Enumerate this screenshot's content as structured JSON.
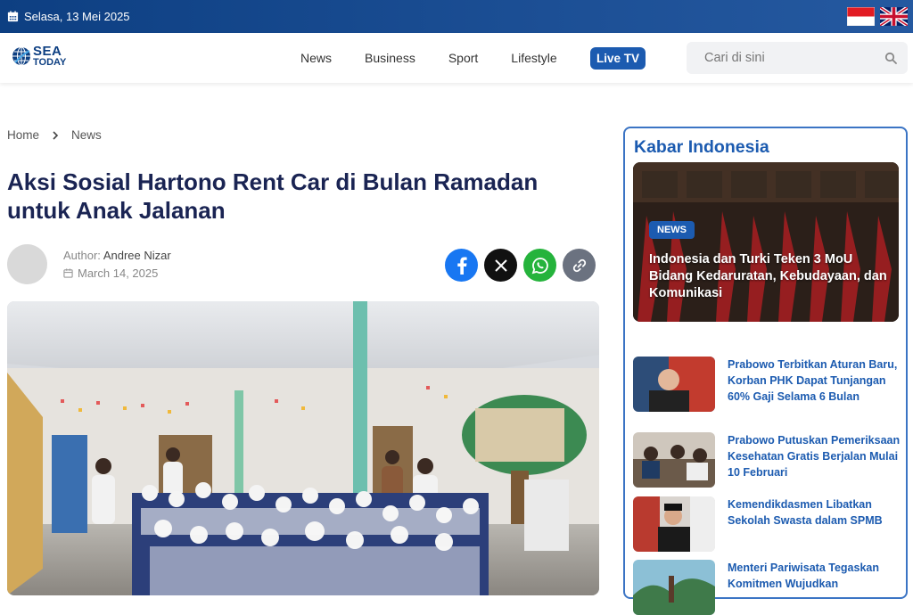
{
  "topbar": {
    "date": "Selasa, 13 Mei 2025",
    "icon": "calendar-icon",
    "flags": [
      "indonesia-flag",
      "uk-flag"
    ]
  },
  "header": {
    "logo_line1": "SEA",
    "logo_line2": "TODAY",
    "nav": [
      "News",
      "Business",
      "Sport",
      "Lifestyle"
    ],
    "live_tv": "Live TV",
    "search_placeholder": "Cari di sini"
  },
  "breadcrumb": {
    "home": "Home",
    "current": "News"
  },
  "article": {
    "title": "Aksi Sosial Hartono Rent Car di Bulan Ramadan untuk Anak Jalanan",
    "author_label": "Author:",
    "author_name": "Andree Nizar",
    "date": "March 14, 2025",
    "share_icons": [
      "facebook-icon",
      "x-icon",
      "whatsapp-icon",
      "link-icon"
    ]
  },
  "sidebar": {
    "heading": "Kabar Indonesia",
    "featured": {
      "badge": "NEWS",
      "title": "Indonesia dan Turki Teken 3 MoU Bidang Kedaruratan, Kebudayaan, dan Komunikasi"
    },
    "items": [
      {
        "title": "Prabowo Terbitkan Aturan Baru, Korban PHK Dapat Tunjangan 60% Gaji Selama 6 Bulan"
      },
      {
        "title": "Prabowo Putuskan Pemeriksaan Kesehatan Gratis Berjalan Mulai 10 Februari"
      },
      {
        "title": "Kemendikdasmen Libatkan Sekolah Swasta dalam SPMB"
      },
      {
        "title": "Menteri Pariwisata Tegaskan Komitmen Wujudkan"
      }
    ]
  },
  "colors": {
    "brand": "#1c5bb0",
    "topbar": "#0d3f82",
    "title": "#1a2453"
  }
}
